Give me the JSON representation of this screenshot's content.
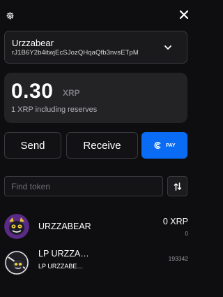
{
  "header": {
    "settings_icon": "gear-icon",
    "close_icon": "close-icon"
  },
  "account": {
    "name": "Urzzabear",
    "address": "rJ1B6Y2b4itwjEcSJozQHqaQfb3nvsETpM",
    "dropdown_icon": "chevron-down-icon"
  },
  "balance": {
    "amount": "0.30",
    "currency": "XRP",
    "reserve_note": "1 XRP including reserves"
  },
  "actions": {
    "send_label": "Send",
    "receive_label": "Receive",
    "pay_label": "PAY"
  },
  "search": {
    "placeholder": "Find token",
    "sort_icon": "sort-icon"
  },
  "tokens": [
    {
      "name": "URZZABEAR",
      "balance": "0 XRP",
      "sub_balance": "0"
    },
    {
      "name": "LP URZZA…",
      "subtitle": "LP URZZABE…",
      "balance": "193342"
    }
  ],
  "colors": {
    "accent": "#0a6cf5",
    "background": "#0e0e10",
    "card": "#232326"
  }
}
